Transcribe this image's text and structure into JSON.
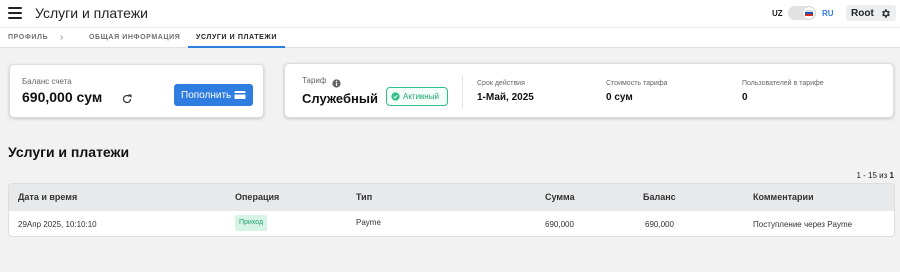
{
  "header": {
    "title": "Услуги и платежи",
    "lang_left": "UZ",
    "lang_right": "RU",
    "user": "Root",
    "accent": "#2f7de1"
  },
  "tabs": [
    {
      "label": "ПРОФИЛЬ",
      "active": false
    },
    {
      "label": "ОБЩАЯ ИНФОРМАЦИЯ",
      "active": false
    },
    {
      "label": "УСЛУГИ И ПЛАТЕЖИ",
      "active": true
    }
  ],
  "balance": {
    "label": "Баланс счета",
    "value": "690,000 сум",
    "topup_label": "Пополнить"
  },
  "tariff": {
    "label": "Тариф",
    "value": "Служебный",
    "status": "Активный",
    "validity_label": "Срок действия",
    "validity_value": "1-Май, 2025",
    "cost_label": "Стоимость тарифа",
    "cost_value": "0 сум",
    "users_label": "Пользователей в тарифе",
    "users_value": "0"
  },
  "section": {
    "title": "Услуги и платежи",
    "pager_range": "1 - 15 из ",
    "pager_total": "1"
  },
  "table": {
    "columns": [
      "Дата и время",
      "Операция",
      "Тип",
      "Сумма",
      "Баланс",
      "Комментарии"
    ],
    "rows": [
      {
        "datetime": "29Апр  2025,    10:10:10",
        "operation": "Приход",
        "type": "Payme",
        "amount": "690,000",
        "balance": "690,000",
        "comment": "Поступление через Payme"
      }
    ]
  }
}
